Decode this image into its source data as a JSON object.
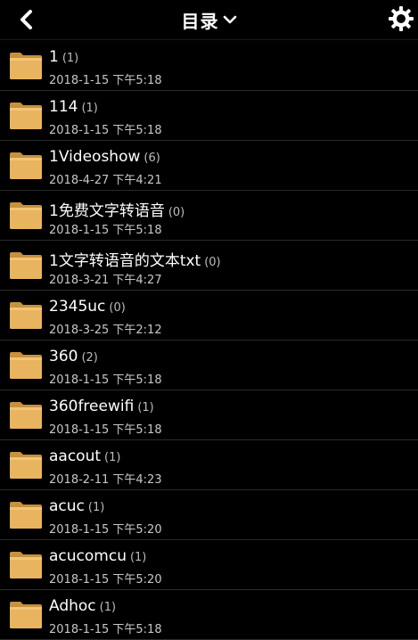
{
  "header": {
    "title": "目录",
    "back_icon": "back-chevron-icon",
    "dropdown_icon": "chevron-down-icon",
    "settings_icon": "gear-icon"
  },
  "colors": {
    "background": "#000000",
    "folder": "#e8b45f",
    "folder_dark": "#c7913e",
    "divider": "#2a2a2a"
  },
  "folders": [
    {
      "name": "1",
      "count": "(1)",
      "date": "2018-1-15 下午5:18"
    },
    {
      "name": "114",
      "count": "(1)",
      "date": "2018-1-15 下午5:18"
    },
    {
      "name": "1Videoshow",
      "count": "(6)",
      "date": "2018-4-27 下午4:21"
    },
    {
      "name": "1免费文字转语音",
      "count": "(0)",
      "date": "2018-1-15 下午5:18"
    },
    {
      "name": "1文字转语音的文本txt",
      "count": "(0)",
      "date": "2018-3-21 下午4:27"
    },
    {
      "name": "2345uc",
      "count": "(0)",
      "date": "2018-3-25 下午2:12"
    },
    {
      "name": "360",
      "count": "(2)",
      "date": "2018-1-15 下午5:18"
    },
    {
      "name": "360freewifi",
      "count": "(1)",
      "date": "2018-1-15 下午5:18"
    },
    {
      "name": "aacout",
      "count": "(1)",
      "date": "2018-2-11 下午4:23"
    },
    {
      "name": "acuc",
      "count": "(1)",
      "date": "2018-1-15 下午5:20"
    },
    {
      "name": "acucomcu",
      "count": "(1)",
      "date": "2018-1-15 下午5:20"
    },
    {
      "name": "Adhoc",
      "count": "(1)",
      "date": "2018-1-15 下午5:18"
    }
  ]
}
